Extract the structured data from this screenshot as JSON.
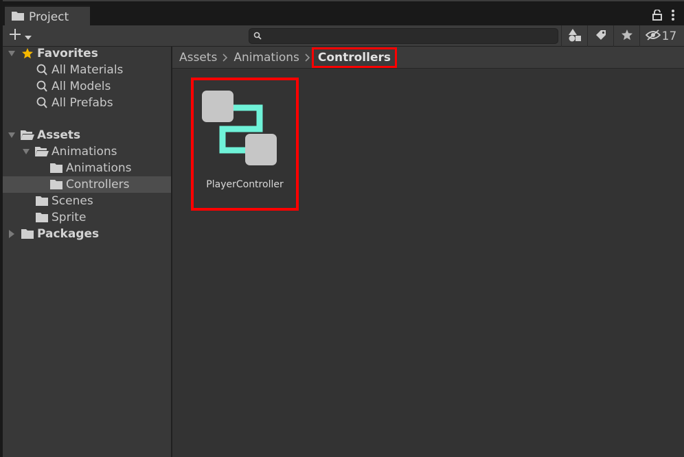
{
  "window": {
    "tab_title": "Project",
    "hidden_count": "17"
  },
  "toolbar": {
    "search_placeholder": ""
  },
  "sidebar": {
    "favorites_label": "Favorites",
    "favorites": [
      "All Materials",
      "All Models",
      "All Prefabs"
    ],
    "assets_label": "Assets",
    "animations_label": "Animations",
    "animations_child": "Animations",
    "controllers_label": "Controllers",
    "scenes_label": "Scenes",
    "sprite_label": "Sprite",
    "packages_label": "Packages"
  },
  "breadcrumb": {
    "items": [
      "Assets",
      "Animations",
      "Controllers"
    ]
  },
  "assets": [
    {
      "name": "PlayerController",
      "icon": "animator-controller-icon"
    }
  ],
  "colors": {
    "highlight": "#ff0000",
    "favorite_star": "#f5b800",
    "controller_link": "#6ff2d8"
  }
}
